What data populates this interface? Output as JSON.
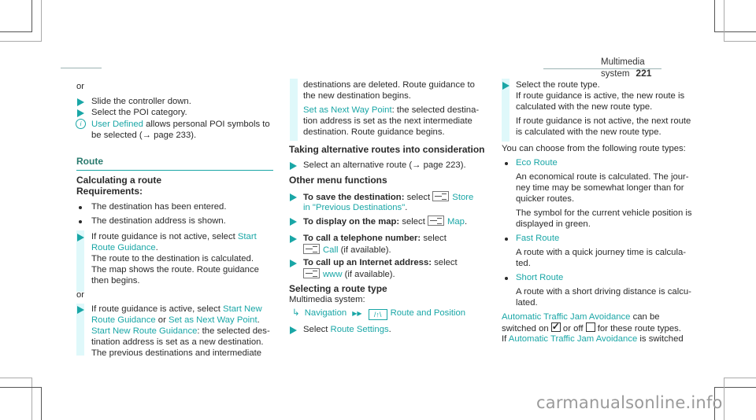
{
  "header": {
    "section": "Multimedia system",
    "page_number": "221"
  },
  "col1": {
    "or_1": "or",
    "steps_a": [
      "Slide the controller down.",
      "Select the POI category."
    ],
    "info": {
      "link": "User Defined",
      "text": " allows personal POI symbols to",
      "text2": "be selected (→ page 233)."
    },
    "section_title": "Route",
    "calc_title": "Calculating a route",
    "req_title": "Requirements:",
    "requirements": [
      "The destination has been entered.",
      "The destination address is shown."
    ],
    "step_b": {
      "pre": "If route guidance is not active, select ",
      "link1": "Start",
      "link2": "Route Guidance",
      "post": ".",
      "lines": [
        "The route to the destination is calculated.",
        "The map shows the route. Route guidance",
        "then begins."
      ]
    },
    "or_2": "or",
    "step_c": {
      "pre": "If route guidance is active, select ",
      "link1": "Start New",
      "link2": "Route Guidance",
      "mid": " or ",
      "link3": "Set as Next Way Point",
      "post": ".",
      "link4": "Start New Route Guidance",
      "line3": ": the selected des-",
      "lines": [
        "tination address is set as a new destination.",
        "The previous destinations and intermediate"
      ]
    }
  },
  "col2": {
    "cont_lines": [
      "destinations are deleted. Route guidance to",
      "the new destination begins."
    ],
    "waypoint": {
      "link": "Set as Next Way Point",
      "text": ": the selected destina-",
      "lines": [
        "tion address is set as the next intermediate",
        "destination. Route guidance begins."
      ]
    },
    "alt_title": "Taking alternative routes into consideration",
    "alt_step": "Select an alternative route (→ page 223).",
    "other_title": "Other menu functions",
    "menu_items": [
      {
        "bold": "To save the destination:",
        "text": " select ",
        "link": "Store",
        "link2": "in \"Previous Destinations\"",
        "post": "."
      },
      {
        "bold": "To display on the map:",
        "text": " select ",
        "link": "Map",
        "post": "."
      },
      {
        "bold": "To call a telephone number:",
        "text": " select",
        "link": "Call",
        "post": " (if available)."
      },
      {
        "bold": "To call up an Internet address:",
        "text": " select",
        "link": "www",
        "post": " (if available)."
      }
    ],
    "select_title": "Selecting a route type",
    "system_label": "Multimedia system:",
    "path": {
      "nav": "Navigation",
      "sep": "▶▶",
      "route_pos": "Route and Position"
    },
    "select_step": {
      "pre": "Select ",
      "link": "Route Settings",
      "post": "."
    }
  },
  "col3": {
    "step": "Select the route type.",
    "lines_a": [
      "If route guidance is active, the new route is",
      "calculated with the new route type."
    ],
    "lines_b": [
      "If route guidance is not active, the next route",
      "is calculated with the new route type."
    ],
    "choose": "You can choose from the following route types:",
    "route_types": [
      {
        "name": "Eco Route",
        "desc": [
          "An economical route is calculated. The jour-",
          "ney time may be somewhat longer than for",
          "quicker routes."
        ],
        "desc2": [
          "The symbol for the current vehicle position is",
          "displayed in green."
        ]
      },
      {
        "name": "Fast Route",
        "desc": [
          "A route with a quick journey time is calcula-",
          "ted."
        ]
      },
      {
        "name": "Short Route",
        "desc": [
          "A route with a short driving distance is calcu-",
          "lated."
        ]
      }
    ],
    "ata": {
      "link": "Automatic Traffic Jam Avoidance",
      "t1": " can be",
      "t2": "switched on",
      "t3": " or off",
      "t4": " for these route types.",
      "t5": "If ",
      "t6": " is switched"
    }
  },
  "watermark": "carmanualsonline.info"
}
